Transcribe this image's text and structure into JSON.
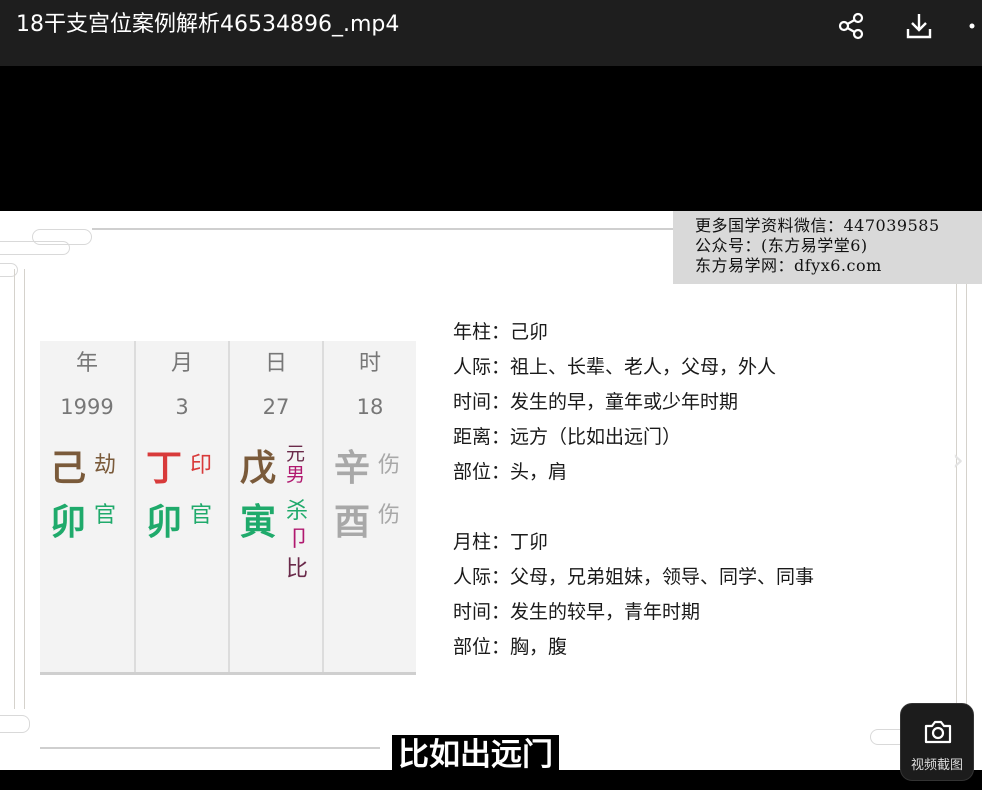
{
  "window": {
    "title": "18干支宫位案例解析46534896_.mp4",
    "actions": [
      "share-icon",
      "download-icon",
      "more-icon"
    ]
  },
  "watermark": {
    "line1": "更多国学资料微信：447039585",
    "line2": "公众号：(东方易学堂6)",
    "line3": "东方易学网：dfyx6.com"
  },
  "bazi": {
    "columns": [
      {
        "header": "年",
        "number": "1999",
        "stem": "己",
        "stem_tag": "劫",
        "branch": "卯",
        "branch_tag": "官"
      },
      {
        "header": "月",
        "number": "3",
        "stem": "丁",
        "stem_tag": "印",
        "branch": "卯",
        "branch_tag": "官"
      },
      {
        "header": "日",
        "number": "27",
        "stem": "戊",
        "stem_tag_top": "元",
        "stem_tag_bottom": "男",
        "branch": "寅",
        "branch_tags": [
          "杀",
          "卩",
          "比"
        ]
      },
      {
        "header": "时",
        "number": "18",
        "stem": "辛",
        "stem_tag": "伤",
        "branch": "酉",
        "branch_tag": "伤"
      }
    ]
  },
  "notes": {
    "year": [
      "年柱：己卯",
      "人际：祖上、长辈、老人，父母，外人",
      "时间：发生的早，童年或少年时期",
      "距离：远方（比如出远门）",
      "部位：头，肩"
    ],
    "month": [
      "月柱：丁卯",
      "人际：父母，兄弟姐妹，领导、同学、同事",
      "时间：发生的较早，青年时期",
      "部位：胸，腹"
    ]
  },
  "subtitle": "比如出远门",
  "screenshot_button": {
    "label": "视频截图",
    "icon": "camera-icon"
  },
  "next_arrow": "›"
}
